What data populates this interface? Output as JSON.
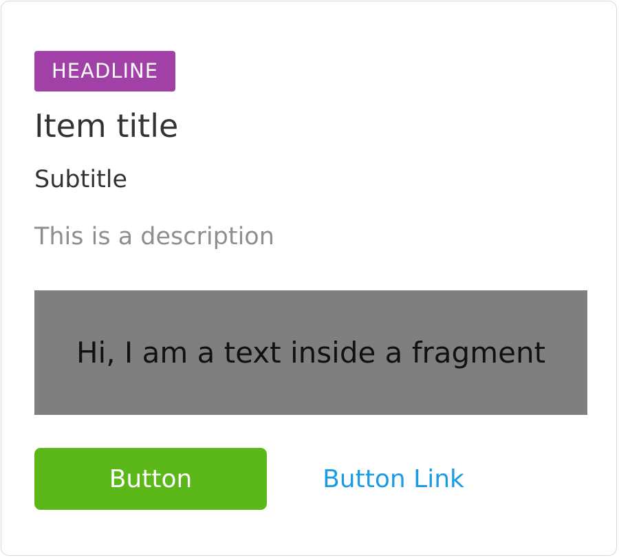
{
  "card": {
    "badge": "HEADLINE",
    "title": "Item title",
    "subtitle": "Subtitle",
    "description": "This is a description",
    "fragment_text": "Hi, I am a text inside a fragment",
    "primary_button": "Button",
    "link_button": "Button Link"
  },
  "colors": {
    "badge_bg": "#a140a7",
    "fragment_bg": "#7f7f7f",
    "primary_button_bg": "#5cb818",
    "link_color": "#1a9be6",
    "description_color": "#8e8e8e"
  }
}
